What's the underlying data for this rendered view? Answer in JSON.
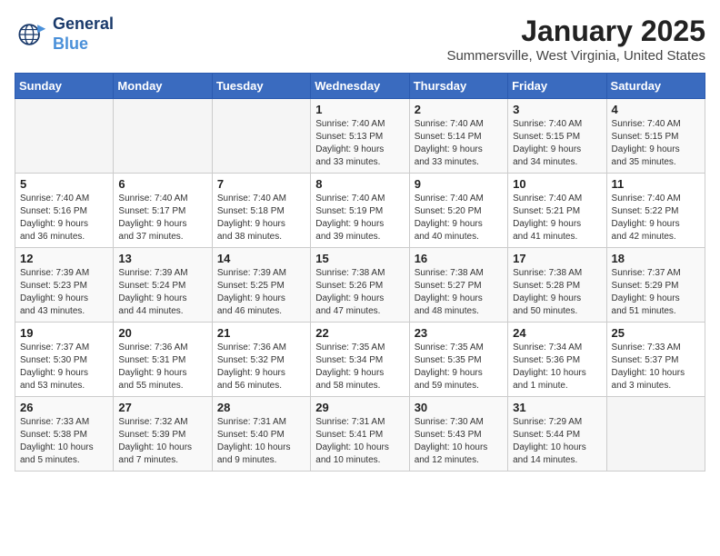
{
  "header": {
    "logo_line1": "General",
    "logo_line2": "Blue",
    "month": "January 2025",
    "location": "Summersville, West Virginia, United States"
  },
  "weekdays": [
    "Sunday",
    "Monday",
    "Tuesday",
    "Wednesday",
    "Thursday",
    "Friday",
    "Saturday"
  ],
  "weeks": [
    [
      {
        "day": "",
        "info": ""
      },
      {
        "day": "",
        "info": ""
      },
      {
        "day": "",
        "info": ""
      },
      {
        "day": "1",
        "info": "Sunrise: 7:40 AM\nSunset: 5:13 PM\nDaylight: 9 hours\nand 33 minutes."
      },
      {
        "day": "2",
        "info": "Sunrise: 7:40 AM\nSunset: 5:14 PM\nDaylight: 9 hours\nand 33 minutes."
      },
      {
        "day": "3",
        "info": "Sunrise: 7:40 AM\nSunset: 5:15 PM\nDaylight: 9 hours\nand 34 minutes."
      },
      {
        "day": "4",
        "info": "Sunrise: 7:40 AM\nSunset: 5:15 PM\nDaylight: 9 hours\nand 35 minutes."
      }
    ],
    [
      {
        "day": "5",
        "info": "Sunrise: 7:40 AM\nSunset: 5:16 PM\nDaylight: 9 hours\nand 36 minutes."
      },
      {
        "day": "6",
        "info": "Sunrise: 7:40 AM\nSunset: 5:17 PM\nDaylight: 9 hours\nand 37 minutes."
      },
      {
        "day": "7",
        "info": "Sunrise: 7:40 AM\nSunset: 5:18 PM\nDaylight: 9 hours\nand 38 minutes."
      },
      {
        "day": "8",
        "info": "Sunrise: 7:40 AM\nSunset: 5:19 PM\nDaylight: 9 hours\nand 39 minutes."
      },
      {
        "day": "9",
        "info": "Sunrise: 7:40 AM\nSunset: 5:20 PM\nDaylight: 9 hours\nand 40 minutes."
      },
      {
        "day": "10",
        "info": "Sunrise: 7:40 AM\nSunset: 5:21 PM\nDaylight: 9 hours\nand 41 minutes."
      },
      {
        "day": "11",
        "info": "Sunrise: 7:40 AM\nSunset: 5:22 PM\nDaylight: 9 hours\nand 42 minutes."
      }
    ],
    [
      {
        "day": "12",
        "info": "Sunrise: 7:39 AM\nSunset: 5:23 PM\nDaylight: 9 hours\nand 43 minutes."
      },
      {
        "day": "13",
        "info": "Sunrise: 7:39 AM\nSunset: 5:24 PM\nDaylight: 9 hours\nand 44 minutes."
      },
      {
        "day": "14",
        "info": "Sunrise: 7:39 AM\nSunset: 5:25 PM\nDaylight: 9 hours\nand 46 minutes."
      },
      {
        "day": "15",
        "info": "Sunrise: 7:38 AM\nSunset: 5:26 PM\nDaylight: 9 hours\nand 47 minutes."
      },
      {
        "day": "16",
        "info": "Sunrise: 7:38 AM\nSunset: 5:27 PM\nDaylight: 9 hours\nand 48 minutes."
      },
      {
        "day": "17",
        "info": "Sunrise: 7:38 AM\nSunset: 5:28 PM\nDaylight: 9 hours\nand 50 minutes."
      },
      {
        "day": "18",
        "info": "Sunrise: 7:37 AM\nSunset: 5:29 PM\nDaylight: 9 hours\nand 51 minutes."
      }
    ],
    [
      {
        "day": "19",
        "info": "Sunrise: 7:37 AM\nSunset: 5:30 PM\nDaylight: 9 hours\nand 53 minutes."
      },
      {
        "day": "20",
        "info": "Sunrise: 7:36 AM\nSunset: 5:31 PM\nDaylight: 9 hours\nand 55 minutes."
      },
      {
        "day": "21",
        "info": "Sunrise: 7:36 AM\nSunset: 5:32 PM\nDaylight: 9 hours\nand 56 minutes."
      },
      {
        "day": "22",
        "info": "Sunrise: 7:35 AM\nSunset: 5:34 PM\nDaylight: 9 hours\nand 58 minutes."
      },
      {
        "day": "23",
        "info": "Sunrise: 7:35 AM\nSunset: 5:35 PM\nDaylight: 9 hours\nand 59 minutes."
      },
      {
        "day": "24",
        "info": "Sunrise: 7:34 AM\nSunset: 5:36 PM\nDaylight: 10 hours\nand 1 minute."
      },
      {
        "day": "25",
        "info": "Sunrise: 7:33 AM\nSunset: 5:37 PM\nDaylight: 10 hours\nand 3 minutes."
      }
    ],
    [
      {
        "day": "26",
        "info": "Sunrise: 7:33 AM\nSunset: 5:38 PM\nDaylight: 10 hours\nand 5 minutes."
      },
      {
        "day": "27",
        "info": "Sunrise: 7:32 AM\nSunset: 5:39 PM\nDaylight: 10 hours\nand 7 minutes."
      },
      {
        "day": "28",
        "info": "Sunrise: 7:31 AM\nSunset: 5:40 PM\nDaylight: 10 hours\nand 9 minutes."
      },
      {
        "day": "29",
        "info": "Sunrise: 7:31 AM\nSunset: 5:41 PM\nDaylight: 10 hours\nand 10 minutes."
      },
      {
        "day": "30",
        "info": "Sunrise: 7:30 AM\nSunset: 5:43 PM\nDaylight: 10 hours\nand 12 minutes."
      },
      {
        "day": "31",
        "info": "Sunrise: 7:29 AM\nSunset: 5:44 PM\nDaylight: 10 hours\nand 14 minutes."
      },
      {
        "day": "",
        "info": ""
      }
    ]
  ]
}
